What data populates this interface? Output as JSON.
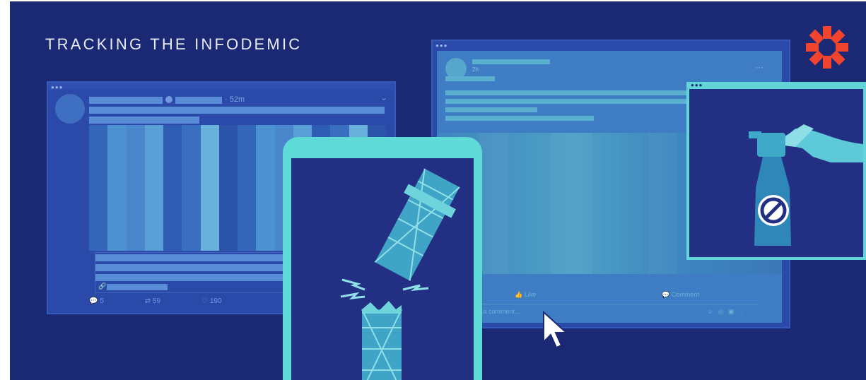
{
  "title": "TRACKING THE INFODEMIC",
  "icons": {
    "logo": "red-starburst-logo",
    "window_dots": "window-dots-icon",
    "cursor": "mouse-pointer-icon",
    "ban": "prohibited-sign-icon",
    "spray": "spray-bottle-icon",
    "tower": "broken-tower-icon"
  },
  "colors": {
    "background": "#1b2873",
    "accent_cyan": "#5edbd6",
    "logo_red": "#f0442e"
  },
  "tweet": {
    "time": "· 52m",
    "replies": "5",
    "retweets": "59",
    "likes": "190"
  },
  "facebook_post": {
    "time": "2h",
    "like_label": "Like",
    "comment_label": "Comment",
    "comment_placeholder": "e a comment..."
  }
}
